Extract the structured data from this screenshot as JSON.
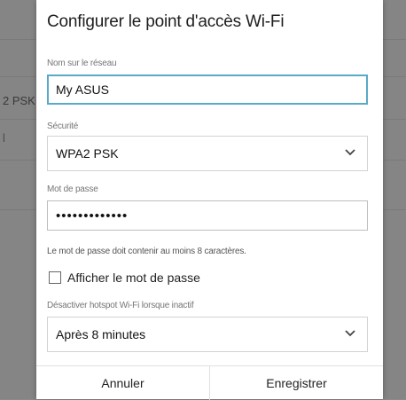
{
  "background": {
    "fragment_1": "2 PSK",
    "fragment_2": "l"
  },
  "dialog": {
    "title": "Configurer le point d'accès Wi-Fi",
    "network_name": {
      "label": "Nom sur le réseau",
      "value": "My ASUS"
    },
    "security": {
      "label": "Sécurité",
      "selected": "WPA2 PSK"
    },
    "password": {
      "label": "Mot de passe",
      "value": "•••••••••••••"
    },
    "password_hint": "Le mot de passe doit contenir au moins 8 caractères.",
    "show_password": {
      "label": "Afficher le mot de passe",
      "checked": false
    },
    "inactivity": {
      "label": "Désactiver hotspot Wi-Fi lorsque inactif",
      "selected": "Après 8 minutes"
    },
    "buttons": {
      "cancel": "Annuler",
      "save": "Enregistrer"
    }
  },
  "colors": {
    "focus_border": "#5aa9c9",
    "dim_overlay": "#858585"
  },
  "icons": {
    "dropdown": "chevron-down-icon",
    "checkbox": "checkbox-unchecked"
  }
}
